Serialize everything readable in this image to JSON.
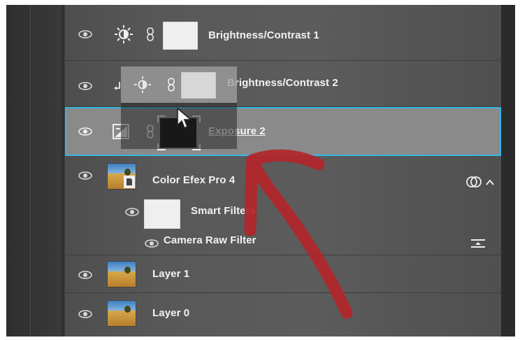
{
  "layers": [
    {
      "name": "Brightness/Contrast 1",
      "type": "adjustment-brightness"
    },
    {
      "name": "Brightness/Contrast 2",
      "type": "adjustment-brightness",
      "clipped": true
    },
    {
      "name": "Exposure 2",
      "type": "adjustment-exposure",
      "selected": true
    },
    {
      "name": "Color Efex Pro 4",
      "type": "smart-object"
    },
    {
      "name": "Smart Filters",
      "type": "smart-filters"
    },
    {
      "name": "Camera Raw Filter",
      "type": "filter"
    },
    {
      "name": "Layer 1",
      "type": "pixel"
    },
    {
      "name": "Layer 0",
      "type": "pixel"
    }
  ],
  "colors": {
    "selection_border": "#35b7e6",
    "annotation_arrow": "#b3262b",
    "panel_bg": "#585858"
  },
  "icons": [
    "eye-icon",
    "sun-icon",
    "link-icon",
    "exposure-icon",
    "smart-object-icon",
    "cursor-icon",
    "overlap-circles-icon",
    "chevron-up-icon",
    "filter-options-icon",
    "clip-arrow-icon"
  ]
}
